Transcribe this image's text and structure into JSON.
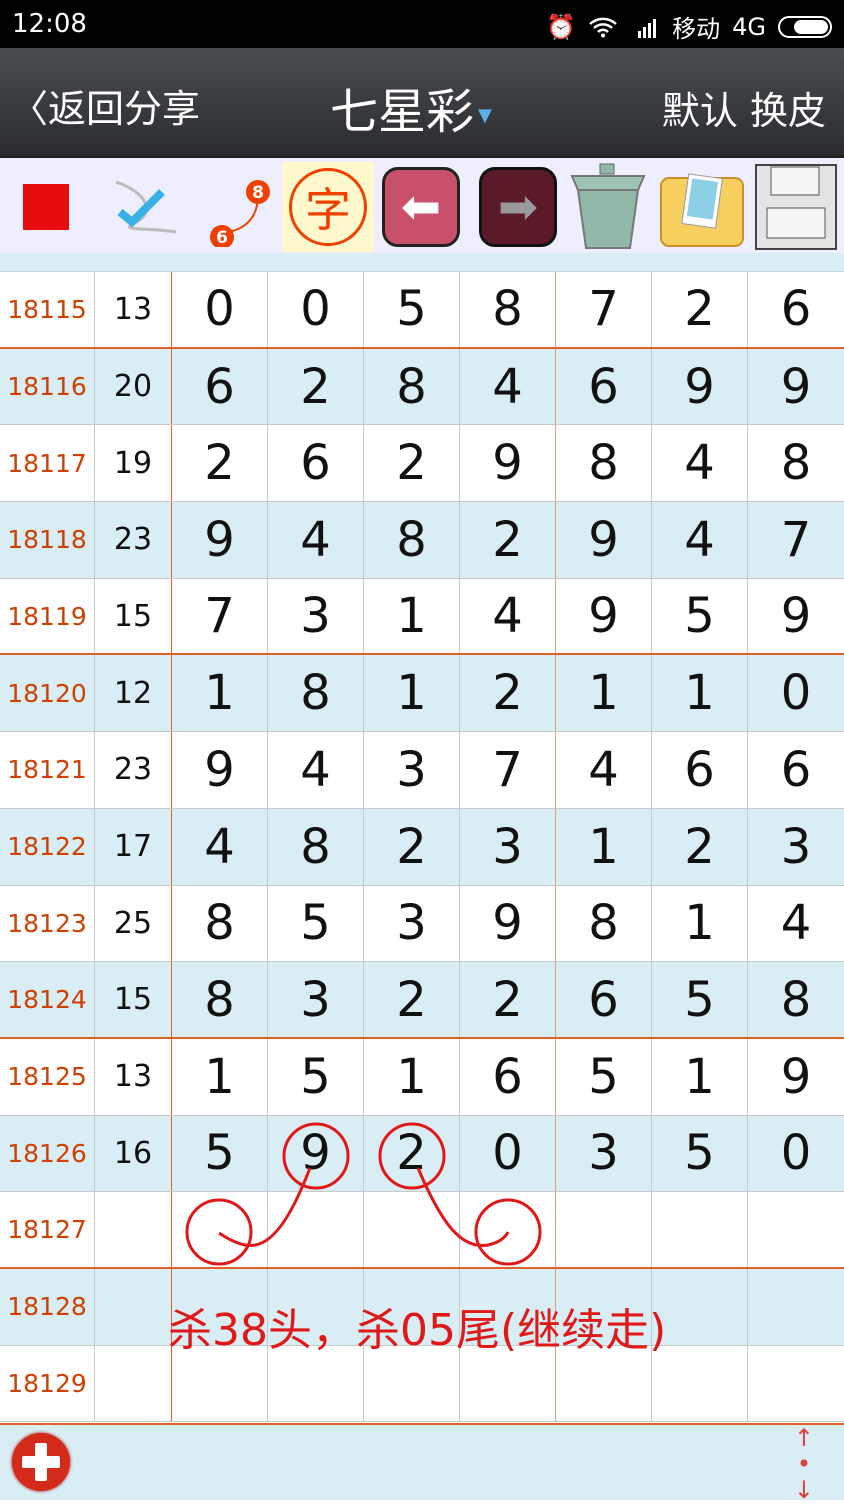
{
  "status_bar": {
    "time": "12:08",
    "carrier": "移动",
    "network": "4G",
    "icons": [
      "alarm-icon",
      "wifi-icon",
      "signal-icon",
      "battery-icon"
    ]
  },
  "nav": {
    "back_label": "返回分享",
    "title": "七星彩",
    "skin_label": "默认 换皮"
  },
  "toolbar": {
    "items": [
      "red-color-swatch",
      "checkmark-pen-icon",
      "connect-line-icon",
      "text-stamp-icon",
      "undo-arrow-icon",
      "redo-arrow-icon",
      "trash-icon",
      "image-folder-icon",
      "save-floppy-icon"
    ],
    "stamp_text": "字",
    "line_labels": [
      "6",
      "8"
    ]
  },
  "rows": [
    {
      "issue": "18115",
      "sum": "13",
      "digits": [
        "0",
        "0",
        "5",
        "8",
        "7",
        "2",
        "6"
      ]
    },
    {
      "issue": "18116",
      "sum": "20",
      "digits": [
        "6",
        "2",
        "8",
        "4",
        "6",
        "9",
        "9"
      ]
    },
    {
      "issue": "18117",
      "sum": "19",
      "digits": [
        "2",
        "6",
        "2",
        "9",
        "8",
        "4",
        "8"
      ]
    },
    {
      "issue": "18118",
      "sum": "23",
      "digits": [
        "9",
        "4",
        "8",
        "2",
        "9",
        "4",
        "7"
      ]
    },
    {
      "issue": "18119",
      "sum": "15",
      "digits": [
        "7",
        "3",
        "1",
        "4",
        "9",
        "5",
        "9"
      ]
    },
    {
      "issue": "18120",
      "sum": "12",
      "digits": [
        "1",
        "8",
        "1",
        "2",
        "1",
        "1",
        "0"
      ]
    },
    {
      "issue": "18121",
      "sum": "23",
      "digits": [
        "9",
        "4",
        "3",
        "7",
        "4",
        "6",
        "6"
      ]
    },
    {
      "issue": "18122",
      "sum": "17",
      "digits": [
        "4",
        "8",
        "2",
        "3",
        "1",
        "2",
        "3"
      ]
    },
    {
      "issue": "18123",
      "sum": "25",
      "digits": [
        "8",
        "5",
        "3",
        "9",
        "8",
        "1",
        "4"
      ]
    },
    {
      "issue": "18124",
      "sum": "15",
      "digits": [
        "8",
        "3",
        "2",
        "2",
        "6",
        "5",
        "8"
      ]
    },
    {
      "issue": "18125",
      "sum": "13",
      "digits": [
        "1",
        "5",
        "1",
        "6",
        "5",
        "1",
        "9"
      ]
    },
    {
      "issue": "18126",
      "sum": "16",
      "digits": [
        "5",
        "9",
        "2",
        "0",
        "3",
        "5",
        "0"
      ]
    },
    {
      "issue": "18127",
      "sum": "",
      "digits": [
        "",
        "",
        "",
        "",
        "",
        "",
        ""
      ]
    },
    {
      "issue": "18128",
      "sum": "",
      "digits": [
        "",
        "",
        "",
        "",
        "",
        "",
        ""
      ]
    },
    {
      "issue": "18129",
      "sum": "",
      "digits": [
        "",
        "",
        "",
        "",
        "",
        "",
        ""
      ]
    }
  ],
  "annotation": {
    "note": "杀38头，杀05尾(继续走)",
    "color": "#e01818"
  },
  "colors": {
    "issue": "#d04000",
    "row_alt": "#d9edf4",
    "divider": "#e0602a"
  }
}
